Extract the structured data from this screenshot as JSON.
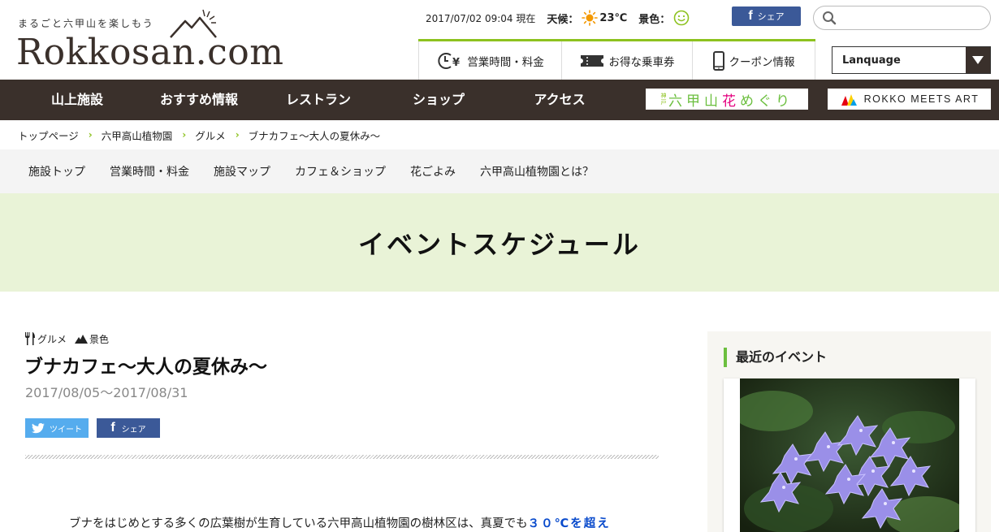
{
  "header": {
    "tagline": "まるごと六甲山を楽しもう",
    "logo_text": "Rokkosan.com",
    "datetime": "2017/07/02 09:04 現在",
    "weather_label": "天候：",
    "temperature": "23℃",
    "scenery_label": "景色：",
    "weather_icon": "sun-icon",
    "scenery_icon": "smile-icon",
    "share_label": "シェア",
    "search_placeholder": "",
    "quick_links": [
      {
        "label": "営業時間・料金",
        "icon": "clock-yen-icon"
      },
      {
        "label": "お得な乗車券",
        "icon": "ticket-icon"
      },
      {
        "label": "クーポン情報",
        "icon": "phone-icon"
      }
    ],
    "language_label": "Lanquage"
  },
  "main_nav": {
    "items": [
      "山上施設",
      "おすすめ情報",
      "レストラン",
      "ショップ",
      "アクセス"
    ],
    "banner_hana_prefix": "神戸",
    "banner_hana_a": "六甲山",
    "banner_hana_b": "花",
    "banner_hana_c": "めぐり",
    "banner_art": "ROKKO MEETS ART"
  },
  "breadcrumb": [
    "トップページ",
    "六甲高山植物園",
    "グルメ",
    "ブナカフェ～大人の夏休み～"
  ],
  "sub_nav": [
    "施設トップ",
    "営業時間・料金",
    "施設マップ",
    "カフェ＆ショップ",
    "花ごよみ",
    "六甲高山植物園とは？"
  ],
  "hero": {
    "title": "イベントスケジュール"
  },
  "article": {
    "categories": [
      {
        "label": "グルメ",
        "icon": "fork-knife-icon"
      },
      {
        "label": "景色",
        "icon": "mountain-icon"
      }
    ],
    "title": "ブナカフェ～大人の夏休み～",
    "date": "2017/08/05～2017/08/31",
    "tweet_label": "ツイート",
    "share_label": "シェア",
    "body_start": "ブナをはじめとする多くの広葉樹が生育している六甲高山植物園の樹林区は、真夏でも",
    "body_highlight": "３０℃を超え"
  },
  "sidebar": {
    "heading": "最近のイベント"
  },
  "colors": {
    "nav_bg": "#3a302b",
    "accent_green": "#8dc21f",
    "hero_bg": "#e9f3d7",
    "facebook": "#3b5998",
    "twitter": "#55acee",
    "highlight_blue": "#0a4bcc"
  }
}
